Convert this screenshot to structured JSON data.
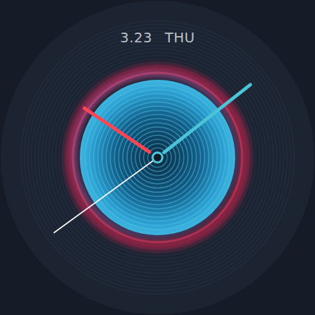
{
  "date": {
    "day_of_month": "3.23",
    "weekday": "THU"
  },
  "time": {
    "hours": 10,
    "minutes": 8,
    "seconds": 39
  }
}
